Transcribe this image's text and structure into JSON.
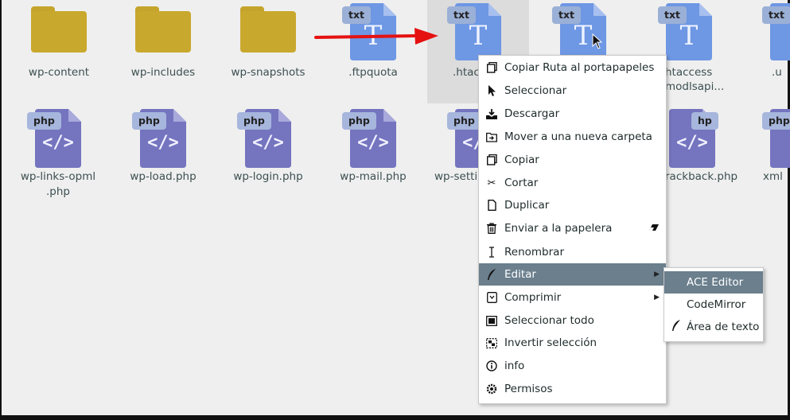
{
  "files_row1": [
    {
      "name": "wp-content",
      "type": "folder"
    },
    {
      "name": "wp-includes",
      "type": "folder"
    },
    {
      "name": "wp-snapshots",
      "type": "folder"
    },
    {
      "name": ".ftpquota",
      "type": "txt",
      "badge": "txt"
    },
    {
      "name": ".htac",
      "type": "txt",
      "badge": "txt"
    },
    {
      "name": "",
      "type": "txt",
      "badge": "txt"
    },
    {
      "name": "htaccess\nmodlsapi...",
      "type": "txt",
      "badge": "txt"
    },
    {
      "name": ".u",
      "type": "txt",
      "badge": "txt"
    }
  ],
  "files_row2": [
    {
      "name": "wp-links-opml\n.php",
      "badge": "php"
    },
    {
      "name": "wp-load.php",
      "badge": "php"
    },
    {
      "name": "wp-login.php",
      "badge": "php"
    },
    {
      "name": "wp-mail.php",
      "badge": "php"
    },
    {
      "name": "wp-setti",
      "badge": "php"
    },
    {
      "name": "rackback.php",
      "badge": "hp"
    },
    {
      "name": "xml",
      "badge": "php"
    }
  ],
  "context_menu": {
    "items": [
      {
        "label": "Copiar Ruta al portapapeles",
        "icon": "copy-icon"
      },
      {
        "label": "Seleccionar",
        "icon": "pointer-icon"
      },
      {
        "label": "Descargar",
        "icon": "download-icon"
      },
      {
        "label": "Mover a una nueva carpeta",
        "icon": "move-folder-icon"
      },
      {
        "label": "Copiar",
        "icon": "copy-icon"
      },
      {
        "label": "Cortar",
        "icon": "scissors-icon"
      },
      {
        "label": "Duplicar",
        "icon": "duplicate-icon"
      },
      {
        "label": "Enviar a la papelera",
        "icon": "trash-icon"
      },
      {
        "label": "Renombrar",
        "icon": "text-cursor-icon"
      },
      {
        "label": "Editar",
        "icon": "quill-icon"
      },
      {
        "label": "Comprimir",
        "icon": "archive-icon"
      },
      {
        "label": "Seleccionar todo",
        "icon": "select-all-icon"
      },
      {
        "label": "Invertir selección",
        "icon": "invert-selection-icon"
      },
      {
        "label": "info",
        "icon": "info-icon"
      },
      {
        "label": "Permisos",
        "icon": "permissions-icon"
      }
    ]
  },
  "edit_submenu": {
    "items": [
      {
        "label": "ACE Editor"
      },
      {
        "label": "CodeMirror"
      },
      {
        "label": "Área de texto",
        "icon": "quill-icon"
      }
    ]
  },
  "colors": {
    "folder": "#c9a82e",
    "txt_doc": "#6e97e4",
    "php_doc": "#7474bf",
    "menu_active": "#6b7f8d",
    "arrow": "#e51111"
  }
}
